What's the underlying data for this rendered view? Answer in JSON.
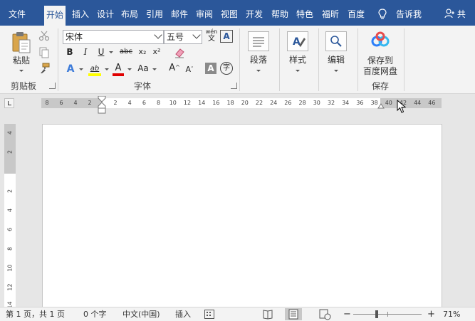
{
  "tabs": [
    {
      "label": "文件",
      "active": false
    },
    {
      "label": "开始",
      "active": true
    },
    {
      "label": "插入",
      "active": false
    },
    {
      "label": "设计",
      "active": false
    },
    {
      "label": "布局",
      "active": false
    },
    {
      "label": "引用",
      "active": false
    },
    {
      "label": "邮件",
      "active": false
    },
    {
      "label": "审阅",
      "active": false
    },
    {
      "label": "视图",
      "active": false
    },
    {
      "label": "开发",
      "active": false
    },
    {
      "label": "帮助",
      "active": false
    },
    {
      "label": "特色",
      "active": false
    },
    {
      "label": "福昕",
      "active": false
    },
    {
      "label": "百度",
      "active": false
    }
  ],
  "tell_me": "告诉我",
  "share": "共",
  "ribbon": {
    "clipboard": {
      "paste_label": "粘贴",
      "group_label": "剪贴板"
    },
    "font": {
      "font_name": "宋体",
      "font_size": "五号",
      "phonetic_top": "wén",
      "phonetic_bottom": "文",
      "border_char": "A",
      "bold": "B",
      "italic": "I",
      "underline": "U",
      "strike": "abc",
      "subscript": "x₂",
      "superscript": "x²",
      "text_effect": "A",
      "highlight": "ab",
      "font_color": "A",
      "change_case": "Aa",
      "grow_font": "A",
      "shrink_font": "A",
      "char_shading": "A",
      "enclose": "字",
      "group_label": "字体"
    },
    "paragraph": {
      "label": "段落"
    },
    "styles": {
      "label": "样式"
    },
    "editing": {
      "label": "编辑"
    },
    "save": {
      "label_line1": "保存到",
      "label_line2": "百度网盘",
      "group_label": "保存"
    }
  },
  "hruler_numbers": [
    "8",
    "6",
    "4",
    "2",
    "2",
    "4",
    "6",
    "8",
    "10",
    "12",
    "14",
    "16",
    "18",
    "20",
    "22",
    "24",
    "26",
    "28",
    "30",
    "32",
    "34",
    "36",
    "38",
    "40",
    "42",
    "44",
    "46"
  ],
  "vruler_numbers": [
    "4",
    "2",
    "2",
    "4",
    "6",
    "8",
    "10",
    "12",
    "14"
  ],
  "status": {
    "page_info": "第 1 页，共 1 页",
    "word_count": "0 个字",
    "language": "中文(中国)",
    "mode": "插入",
    "zoom_minus": "−",
    "zoom_plus": "+",
    "zoom_level": "71%",
    "zoom_fraction": 0.71
  },
  "colors": {
    "accent": "#2b579a",
    "highlight_yellow": "#ffff00",
    "font_red": "#e00000",
    "baidu_blue": "#2d7ff9"
  }
}
